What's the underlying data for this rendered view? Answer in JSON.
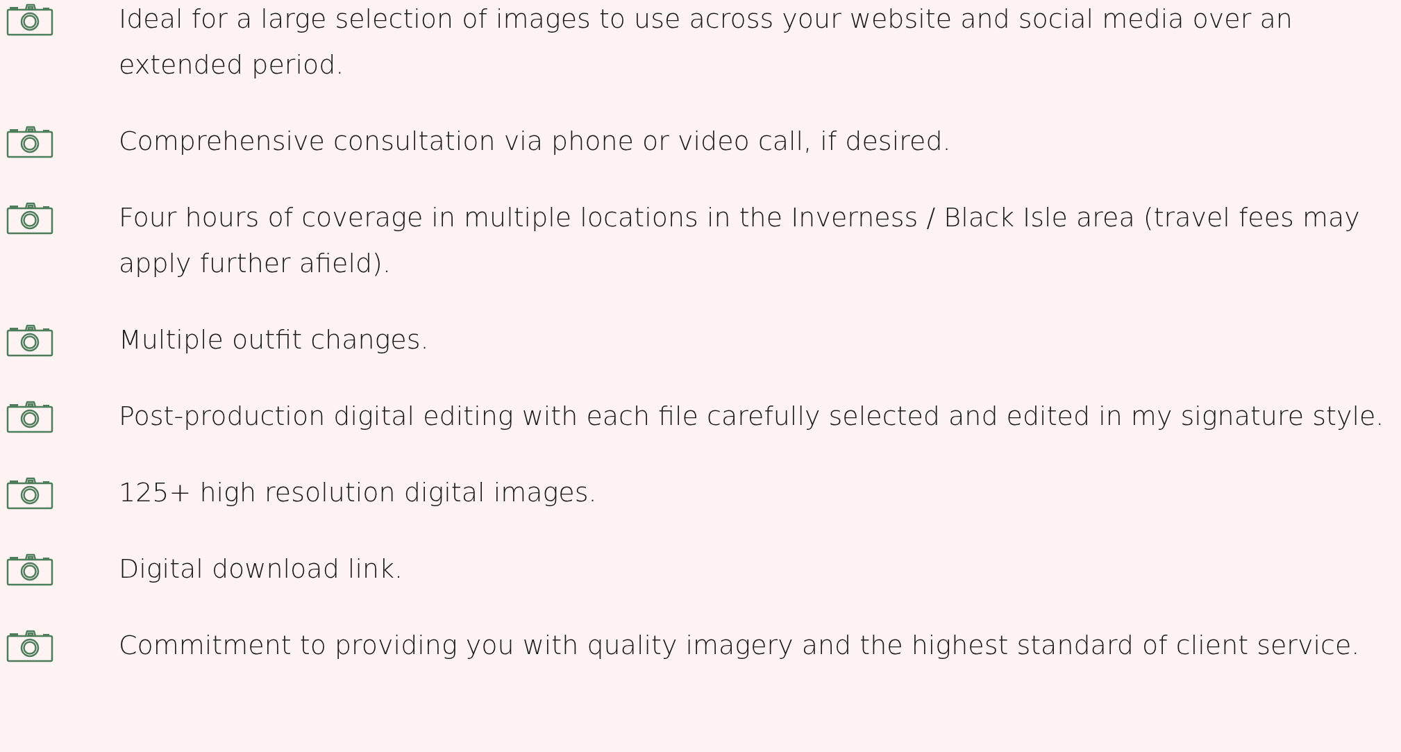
{
  "features": [
    {
      "text": "Ideal for a large selection of images to use across your website and social media over an extended period."
    },
    {
      "text": "Comprehensive consultation via phone or video call, if desired."
    },
    {
      "text": "Four hours of coverage in multiple locations in the Inverness / Black Isle area (travel fees may apply further afield)."
    },
    {
      "text": "Multiple outfit changes."
    },
    {
      "text": "Post-production digital editing with each file carefully selected and edited in my signature style."
    },
    {
      "text": "125+ high resolution digital images."
    },
    {
      "text": "Digital download link."
    },
    {
      "text": "Commitment to providing you with quality imagery and the highest standard of client service."
    }
  ]
}
